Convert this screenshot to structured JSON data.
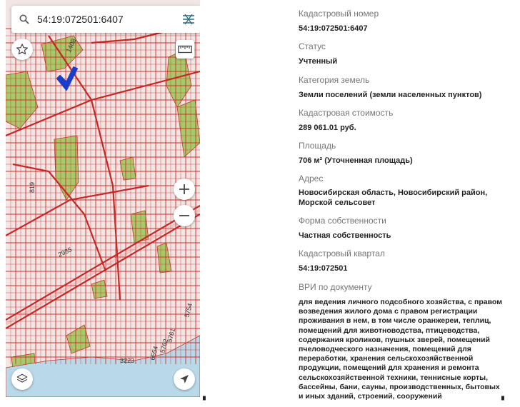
{
  "search": {
    "value": "54:19:072501:6407"
  },
  "map": {
    "labels": {
      "street_top": "1408",
      "lot_left": "819",
      "lot_mid": "2985",
      "lot_bottom": "3223",
      "lot_right_a": "5761",
      "lot_right_b": "5762",
      "lot_right_c": "5761",
      "lot_right_d": "6554",
      "lot_right_e": "5754"
    },
    "colors": {
      "parcel_line": "#d22f2f",
      "parcel_fill": "#f1e6e4",
      "green": "#a6c96a",
      "water": "#b9d9e8",
      "marker": "#1a3ec9"
    }
  },
  "info": {
    "cadastral_number": {
      "label": "Кадастровый номер",
      "value": "54:19:072501:6407"
    },
    "status": {
      "label": "Статус",
      "value": "Учтенный"
    },
    "land_category": {
      "label": "Категория земель",
      "value": "Земли поселений (земли населенных пунктов)"
    },
    "cadastral_value": {
      "label": "Кадастровая стоимость",
      "value": "289 061.01 руб."
    },
    "area": {
      "label": "Площадь",
      "value": "706 м² (Уточненная площадь)"
    },
    "address": {
      "label": "Адрес",
      "lines": [
        "Новосибирская область, Новосибирский район,",
        "Морской сельсовет"
      ]
    },
    "ownership": {
      "label": "Форма собственности",
      "value": "Частная собственность"
    },
    "cadastral_quarter": {
      "label": "Кадастровый квартал",
      "value": "54:19:072501"
    },
    "permitted_use": {
      "label": "ВРИ по документу",
      "lines": [
        "для ведения личного подсобного хозяйства, с правом",
        "возведения жилого дома с правом регистрации",
        "проживания в нем, в том числе оранжереи, теплиц,",
        "помещений для животноводства, птицеводства,",
        "содержания кроликов, пушных зверей, помещений",
        "пчеловодческого назначения, помещений для",
        "переработки, хранения сельскохозяйственной",
        "продукции, помещений для хранения и ремонта",
        "сельскохозяйственной техники, теннисные корты,",
        "бассейны, бани, сауны, производственных, бытовых",
        "и иных зданий, строений, сооружений"
      ]
    }
  }
}
